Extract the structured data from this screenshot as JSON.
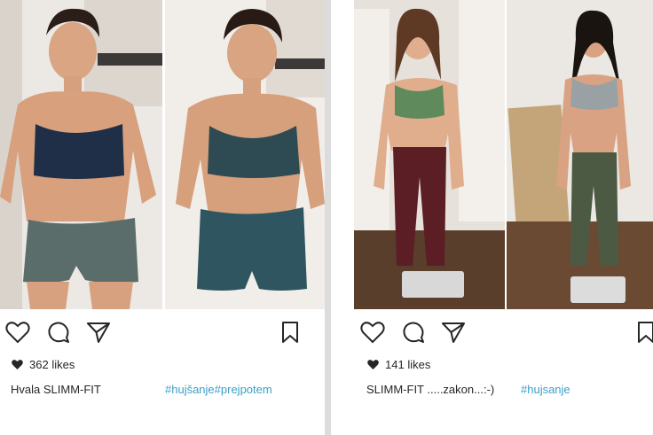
{
  "posts": [
    {
      "likes_count": "362",
      "likes_word": "likes",
      "caption": "Hvala SLIMM-FIT",
      "hashtags": "#hujšanje#prejpotem",
      "icons": [
        "heart-icon",
        "comment-icon",
        "share-icon",
        "bookmark-icon"
      ]
    },
    {
      "likes_count": "141",
      "likes_word": "likes",
      "caption": "SLIMM-FIT .....zakon...:-)",
      "hashtags": "#hujsanje",
      "icons": [
        "heart-icon",
        "comment-icon",
        "share-icon",
        "bookmark-icon"
      ]
    }
  ],
  "colors": {
    "hashtag": "#3aa0c8",
    "text": "#262626",
    "icon_stroke": "#262626"
  }
}
